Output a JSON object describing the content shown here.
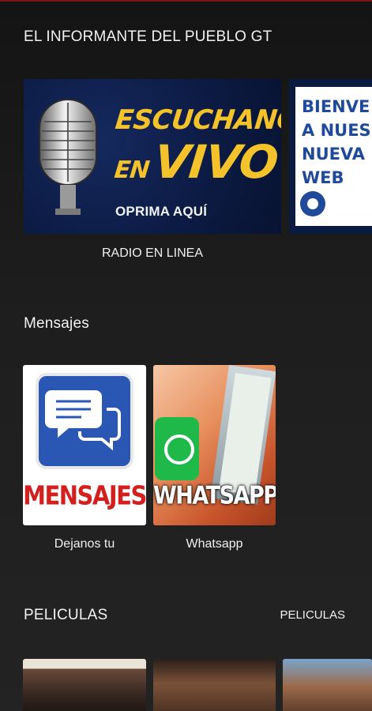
{
  "app": {
    "accent_color": "#7a1515"
  },
  "sections": {
    "radio": {
      "title": "EL INFORMANTE DEL PUEBLO GT",
      "items": [
        {
          "label": "RADIO EN LINEA",
          "banner_line1": "ESCUCHANOS",
          "banner_line2_small": "EN",
          "banner_line2_big": "VIVO",
          "banner_line3": "OPRIMA AQUÍ",
          "text_color": "#f4c22a",
          "bg_color": "#0c1a42"
        },
        {
          "banner_text": "BIENVE\nA NUES\nNUEVA\nWEB",
          "text_color": "#1e4a99"
        }
      ]
    },
    "mensajes": {
      "title": "Mensajes",
      "items": [
        {
          "label": "Dejanos tu",
          "tile_text": "MENSAJES",
          "icon": "chat-bubbles-icon"
        },
        {
          "label": "Whatsapp",
          "tile_text": "WHATSAPP",
          "icon": "whatsapp-icon"
        }
      ]
    },
    "peliculas": {
      "title": "PELICULAS",
      "action_label": "PELICULAS",
      "items": [
        {
          "poster": "movie-poster-romance"
        },
        {
          "poster": "movie-poster-action"
        },
        {
          "poster": "movie-poster-adventure"
        }
      ]
    }
  }
}
